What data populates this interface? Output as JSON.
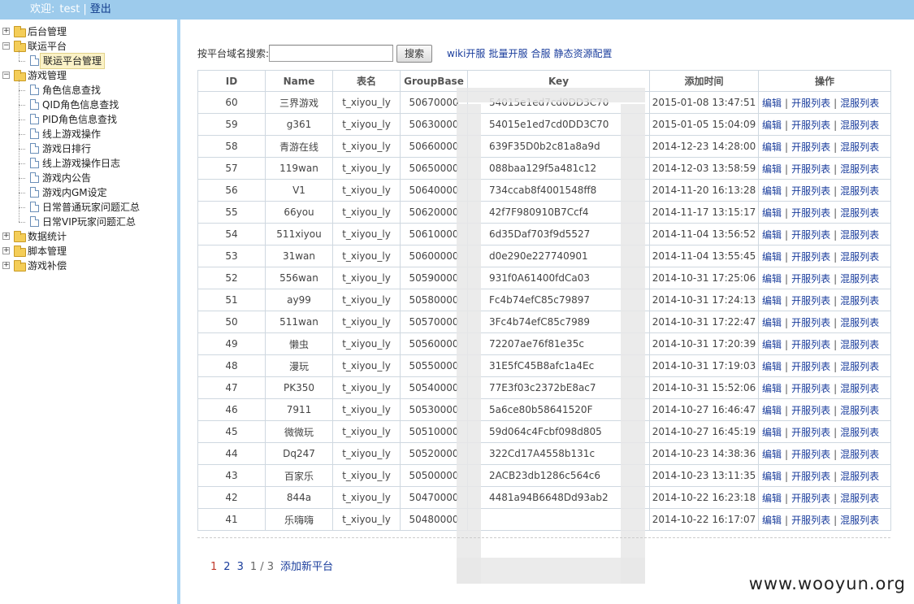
{
  "header": {
    "welcome": "欢迎:",
    "user": "test",
    "sep": "|",
    "logout": "登出"
  },
  "sidebar": {
    "items": [
      {
        "label": "后台管理",
        "type": "folder",
        "expander": "+"
      },
      {
        "label": "联运平台",
        "type": "folder",
        "expander": "−"
      },
      {
        "label": "联运平台管理",
        "type": "page",
        "selected": true
      },
      {
        "label": "游戏管理",
        "type": "folder",
        "expander": "−"
      },
      {
        "label": "角色信息查找",
        "type": "page"
      },
      {
        "label": "QID角色信息查找",
        "type": "page"
      },
      {
        "label": "PID角色信息查找",
        "type": "page"
      },
      {
        "label": "线上游戏操作",
        "type": "page"
      },
      {
        "label": "游戏日排行",
        "type": "page"
      },
      {
        "label": "线上游戏操作日志",
        "type": "page"
      },
      {
        "label": "游戏内公告",
        "type": "page"
      },
      {
        "label": "游戏内GM设定",
        "type": "page"
      },
      {
        "label": "日常普通玩家问题汇总",
        "type": "page"
      },
      {
        "label": "日常VIP玩家问题汇总",
        "type": "page"
      },
      {
        "label": "数据统计",
        "type": "folder",
        "expander": "+"
      },
      {
        "label": "脚本管理",
        "type": "folder",
        "expander": "+"
      },
      {
        "label": "游戏补偿",
        "type": "folder",
        "expander": "+"
      }
    ]
  },
  "search": {
    "label": "按平台域名搜索:",
    "value": "",
    "button": "搜索",
    "links": [
      "wiki开服",
      "批量开服",
      "合服",
      "静态资源配置"
    ]
  },
  "table": {
    "columns": [
      "ID",
      "Name",
      "表名",
      "GroupBase",
      "Key",
      "添加时间",
      "操作"
    ],
    "ops": [
      "编辑",
      "开服列表",
      "混服列表"
    ],
    "rows": [
      [
        "60",
        "三界游戏",
        "t_xiyou_ly",
        "50670000",
        "54015e1ed7cd0DD3C70",
        "2015-01-08 13:47:51"
      ],
      [
        "59",
        "g361",
        "t_xiyou_ly",
        "50630000",
        "54015e1ed7cd0DD3C70",
        "2015-01-05 15:04:09"
      ],
      [
        "58",
        "青游在线",
        "t_xiyou_ly",
        "50660000",
        "639F35D0b2c81a8a9d",
        "2014-12-23 14:28:00"
      ],
      [
        "57",
        "119wan",
        "t_xiyou_ly",
        "50650000",
        "088baa129f5a481c12",
        "2014-12-03 13:58:59"
      ],
      [
        "56",
        "V1",
        "t_xiyou_ly",
        "50640000",
        "734ccab8f4001548ff8",
        "2014-11-20 16:13:28"
      ],
      [
        "55",
        "66you",
        "t_xiyou_ly",
        "50620000",
        "42f7F980910B7Ccf4",
        "2014-11-17 13:15:17"
      ],
      [
        "54",
        "511xiyou",
        "t_xiyou_ly",
        "50610000",
        "6d35Daf703f9d5527",
        "2014-11-04 13:56:52"
      ],
      [
        "53",
        "31wan",
        "t_xiyou_ly",
        "50600000",
        "d0e290e227740901",
        "2014-11-04 13:55:45"
      ],
      [
        "52",
        "556wan",
        "t_xiyou_ly",
        "50590000",
        "931f0A61400fdCa03",
        "2014-10-31 17:25:06"
      ],
      [
        "51",
        "ay99",
        "t_xiyou_ly",
        "50580000",
        "Fc4b74efC85c79897",
        "2014-10-31 17:24:13"
      ],
      [
        "50",
        "511wan",
        "t_xiyou_ly",
        "50570000",
        "3Fc4b74efC85c7989",
        "2014-10-31 17:22:47"
      ],
      [
        "49",
        "懒虫",
        "t_xiyou_ly",
        "50560000",
        "72207ae76f81e35c",
        "2014-10-31 17:20:39"
      ],
      [
        "48",
        "漫玩",
        "t_xiyou_ly",
        "50550000",
        "31E5fC45B8afc1a4Ec",
        "2014-10-31 17:19:03"
      ],
      [
        "47",
        "PK350",
        "t_xiyou_ly",
        "50540000",
        "77E3f03c2372bE8ac7",
        "2014-10-31 15:52:06"
      ],
      [
        "46",
        "7911",
        "t_xiyou_ly",
        "50530000",
        "5a6ce80b58641520F",
        "2014-10-27 16:46:47"
      ],
      [
        "45",
        "微微玩",
        "t_xiyou_ly",
        "50510000",
        "59d064c4Fcbf098d805",
        "2014-10-27 16:45:19"
      ],
      [
        "44",
        "Dq247",
        "t_xiyou_ly",
        "50520000",
        "322Cd17A4558b131c",
        "2014-10-23 14:38:36"
      ],
      [
        "43",
        "百家乐",
        "t_xiyou_ly",
        "50500000",
        "2ACB23db1286c564c6",
        "2014-10-23 13:11:35"
      ],
      [
        "42",
        "844a",
        "t_xiyou_ly",
        "50470000",
        "4481a94B6648Dd93ab2",
        "2014-10-22 16:23:18"
      ],
      [
        "41",
        "乐嗨嗨",
        "t_xiyou_ly",
        "50480000",
        "",
        "2014-10-22 16:17:07"
      ]
    ]
  },
  "pager": {
    "pages": [
      "1",
      "2",
      "3"
    ],
    "current": "1",
    "info": "1 / 3",
    "add": "添加新平台"
  },
  "watermark": "www.wooyun.org"
}
